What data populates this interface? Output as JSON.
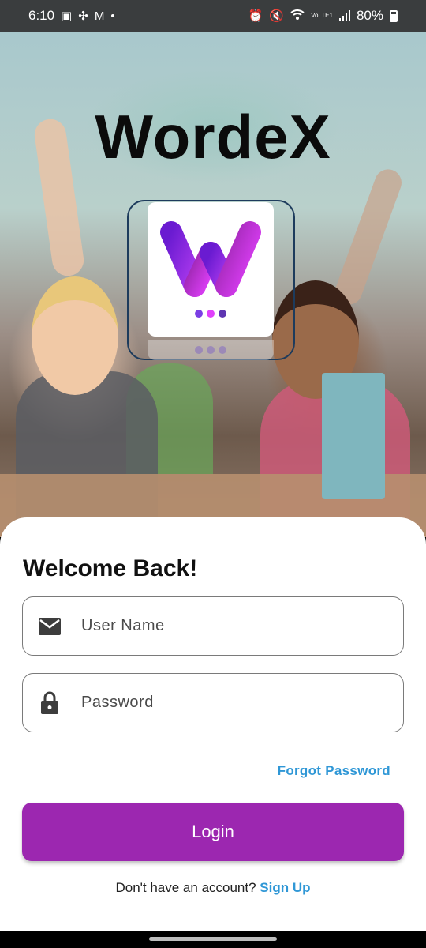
{
  "status_bar": {
    "time": "6:10",
    "battery": "80%",
    "icons": [
      "gallery-icon",
      "pinwheel-icon",
      "gmail-icon",
      "dot-icon",
      "alarm-icon",
      "mute-icon",
      "wifi-icon",
      "volte-icon",
      "signal-icon",
      "battery-icon"
    ],
    "volte_label": "VoLTE1"
  },
  "hero": {
    "app_title": "WordeX",
    "logo_icon": "wordex-w-logo",
    "logo_dot_colors": [
      "#7b3fe4",
      "#e040fb",
      "#5e35b1"
    ]
  },
  "login": {
    "heading": "Welcome Back!",
    "username_placeholder": "User Name",
    "username_icon": "mail-icon",
    "password_placeholder": "Password",
    "password_icon": "lock-icon",
    "forgot_label": "Forgot Password",
    "login_label": "Login",
    "signup_prompt": "Don't have an account?",
    "signup_label": "Sign Up"
  },
  "colors": {
    "primary": "#9c27b0",
    "link": "#2f97d6",
    "logo_gradient_start": "#9c27b0",
    "logo_gradient_end": "#e040fb"
  }
}
